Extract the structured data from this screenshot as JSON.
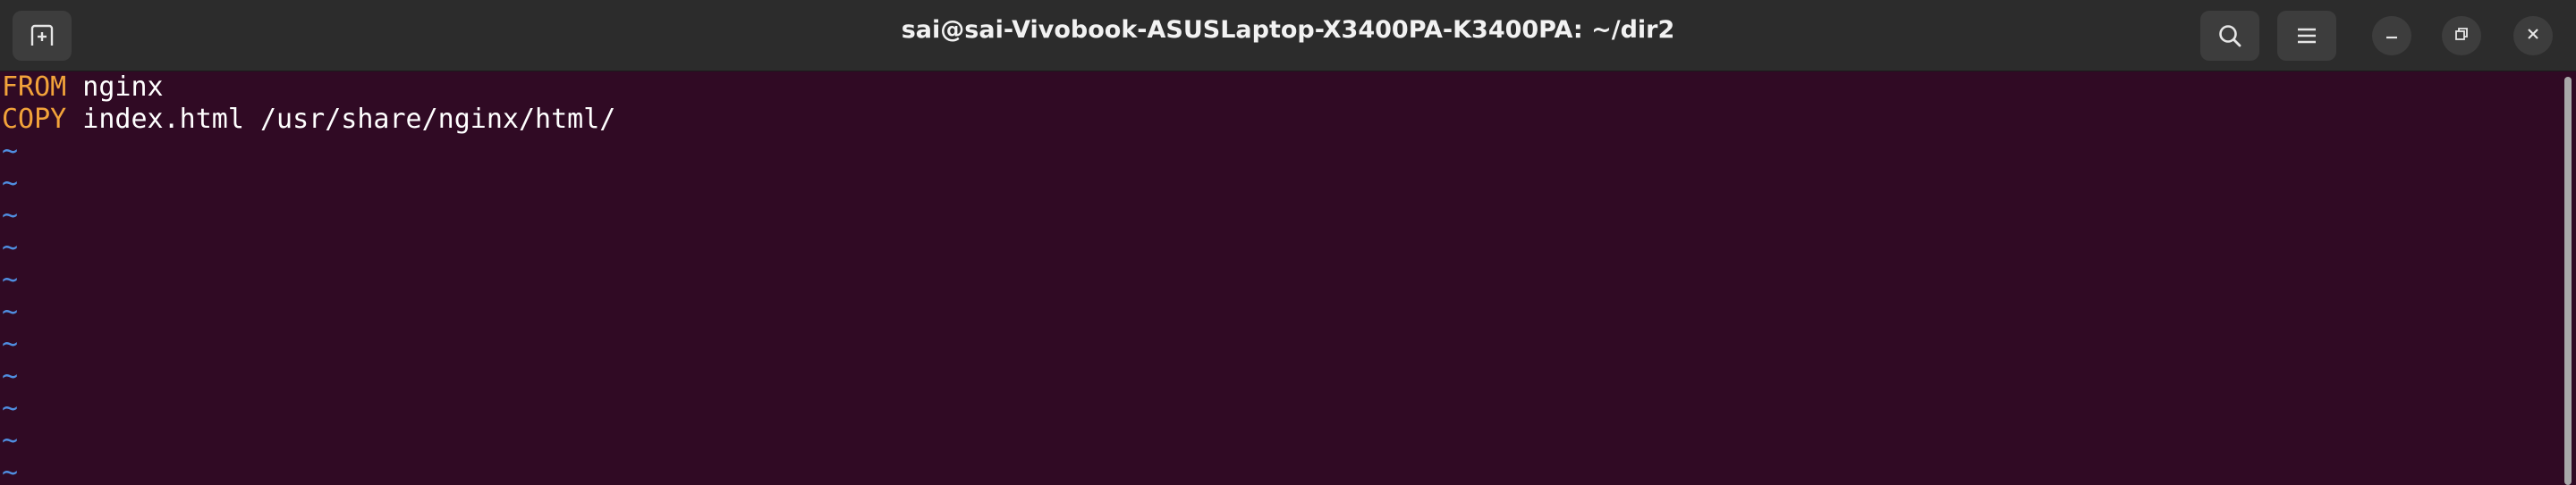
{
  "window": {
    "title": "sai@sai-Vivobook-ASUSLaptop-X3400PA-K3400PA: ~/dir2"
  },
  "icons": {
    "new_tab": "new-tab-icon",
    "search": "search-icon",
    "menu": "hamburger-menu-icon",
    "minimize": "minimize-icon",
    "restore": "restore-icon",
    "close": "close-icon"
  },
  "colors": {
    "terminal_background": "#300a24",
    "keyword": "#f2a33a",
    "tilde": "#4f8ee0",
    "text": "#ffffff"
  },
  "editor": {
    "lines": [
      {
        "keyword": "FROM",
        "rest": " nginx"
      },
      {
        "keyword": "COPY",
        "rest": " index.html /usr/share/nginx/html/"
      }
    ],
    "empty_marker": "~",
    "empty_lines": 11
  }
}
